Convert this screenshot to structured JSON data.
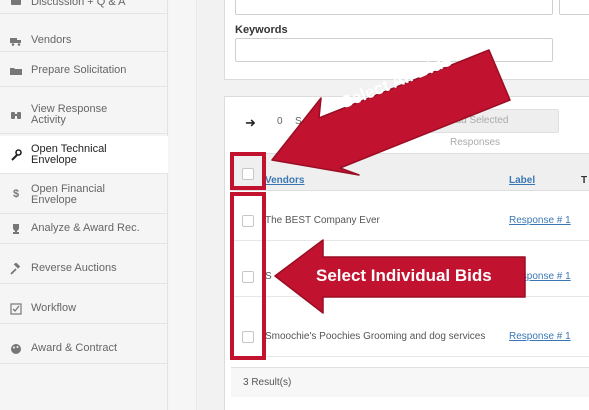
{
  "sidebar": {
    "items": [
      {
        "label": "Discussion + Q & A",
        "icon": "discussion-icon"
      },
      {
        "label": "Vendors",
        "icon": "truck-icon"
      },
      {
        "label": "Prepare Solicitation",
        "icon": "folder-icon"
      },
      {
        "label": "View Response Activity",
        "line1": "View Response",
        "line2": "Activity",
        "icon": "binoculars-icon"
      },
      {
        "label": "Open Technical Envelope",
        "line1": "Open Technical",
        "line2": "Envelope",
        "icon": "wrench-icon",
        "active": true
      },
      {
        "label": "Open Financial Envelope",
        "line1": "Open Financial",
        "line2": "Envelope",
        "icon": "dollar-icon"
      },
      {
        "label": "Analyze & Award Rec.",
        "icon": "trophy-icon"
      },
      {
        "label": "Reverse Auctions",
        "icon": "gavel-icon"
      },
      {
        "label": "Workflow",
        "icon": "checkbox-icon"
      },
      {
        "label": "Award & Contract",
        "icon": "palette-icon"
      }
    ]
  },
  "filters": {
    "keywords_label": "Keywords"
  },
  "toolbar": {
    "count": "0",
    "s": "S",
    "download_label": "oad Selected Responses"
  },
  "table": {
    "headers": {
      "vendors": "Vendors",
      "label": "Label",
      "t": "T"
    },
    "rows": [
      {
        "vendor": "The BEST Company Ever",
        "label": "Response # 1"
      },
      {
        "vendor": "S",
        "label": "Response # 1"
      },
      {
        "vendor": "Smoochie's Poochies Grooming and dog services",
        "label": "Response # 1"
      }
    ],
    "results": "3 Result(s)"
  },
  "annotations": {
    "select_all": "Select All Bids",
    "select_individual": "Select Individual Bids"
  },
  "colors": {
    "accent_red": "#c1122f",
    "link_blue": "#3a78b5"
  }
}
